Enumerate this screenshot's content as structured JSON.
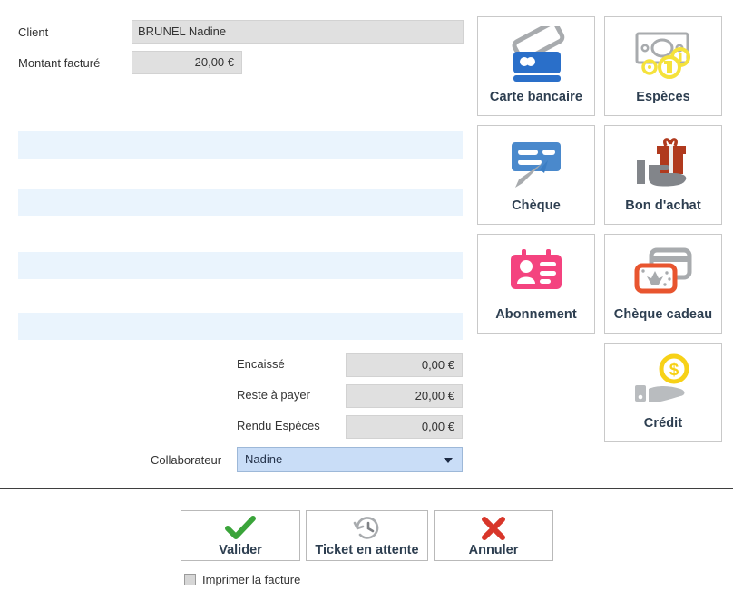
{
  "form": {
    "client_label": "Client",
    "client_value": "BRUNEL Nadine",
    "montant_label": "Montant facturé",
    "montant_value": "20,00 €"
  },
  "payment_lines": [
    {
      "row": ""
    },
    {
      "row": ""
    },
    {
      "row": ""
    },
    {
      "row": ""
    }
  ],
  "totals": {
    "encaisse_label": "Encaissé",
    "encaisse_value": "0,00 €",
    "reste_label": "Reste à payer",
    "reste_value": "20,00 €",
    "rendu_label": "Rendu Espèces",
    "rendu_value": "0,00 €"
  },
  "collaborateur": {
    "label": "Collaborateur",
    "selected": "Nadine",
    "icon": "chevron-down-icon"
  },
  "payment_methods": [
    {
      "label": "Carte bancaire",
      "icon": "credit-card-icon"
    },
    {
      "label": "Espèces",
      "icon": "banknote-coins-icon"
    },
    {
      "label": "Chèque",
      "icon": "cheque-pen-icon"
    },
    {
      "label": "Bon d'achat",
      "icon": "hand-gift-icon"
    },
    {
      "label": "Abonnement",
      "icon": "id-badge-icon"
    },
    {
      "label": "Chèque cadeau",
      "icon": "gift-card-icon"
    },
    {
      "label": "Crédit",
      "icon": "hand-coin-icon"
    }
  ],
  "actions": [
    {
      "label": "Valider",
      "icon": "check-icon"
    },
    {
      "label": "Ticket en attente",
      "icon": "clock-history-icon"
    },
    {
      "label": "Annuler",
      "icon": "cross-icon"
    }
  ],
  "print_invoice": {
    "label": "Imprimer la facture",
    "checked": false
  },
  "colors": {
    "tile_label": "#2d3e50",
    "card_blue": "#2a6fc9",
    "cheque_blue": "#4a89cc",
    "cash_yellow": "#f5e23c",
    "gift_red": "#b03a1e",
    "badge_pink": "#f4437f",
    "giftcard_orange": "#e8552f",
    "credit_yellow": "#f7d117",
    "grey": "#a0a3a6",
    "valid_green": "#3aa43a",
    "cancel_red": "#d8362a",
    "row_blue": "#eaf4fd",
    "field_grey": "#e0e0e0",
    "select_blue": "#c9ddf7"
  }
}
